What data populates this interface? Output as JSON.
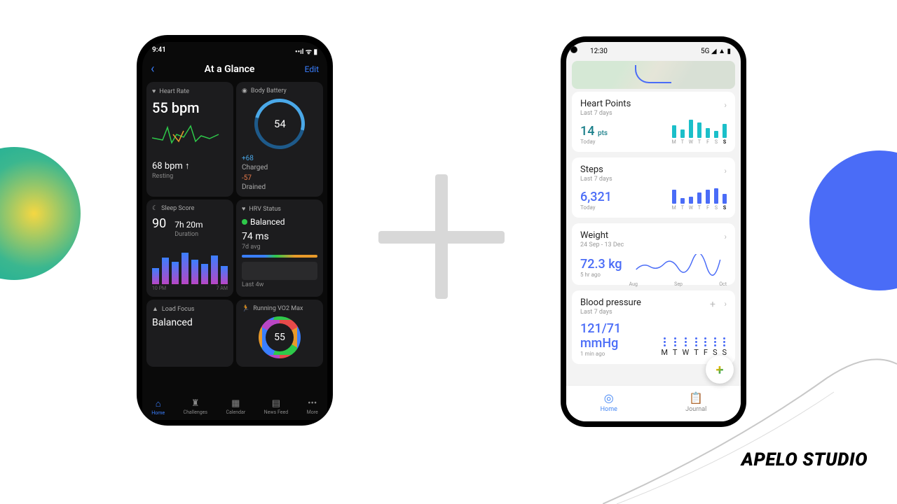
{
  "brand": "APELO STUDIO",
  "phone1": {
    "status_time": "9:41",
    "header": {
      "title": "At a Glance",
      "edit": "Edit"
    },
    "heart_rate": {
      "label": "Heart Rate",
      "value": "55 bpm",
      "resting_value": "68 bpm ↑",
      "resting_label": "Resting"
    },
    "body_battery": {
      "label": "Body Battery",
      "value": "54",
      "charged_value": "+68",
      "charged_label": "Charged",
      "drained_value": "-57",
      "drained_label": "Drained"
    },
    "sleep": {
      "label": "Sleep Score",
      "score": "90",
      "duration": "7h 20m",
      "duration_label": "Duration",
      "time_start": "10 PM",
      "time_end": "7 AM"
    },
    "hrv": {
      "label": "HRV Status",
      "status": "Balanced",
      "value": "74 ms",
      "sub": "7d avg",
      "period": "Last 4w"
    },
    "load_focus": {
      "label": "Load Focus",
      "value": "Balanced"
    },
    "vo2": {
      "label": "Running VO2 Max",
      "value": "55"
    },
    "tabs": {
      "home": "Home",
      "challenges": "Challenges",
      "calendar": "Calendar",
      "newsfeed": "News Feed",
      "more": "More"
    }
  },
  "phone2": {
    "status_time": "12:30",
    "status_net": "5G",
    "heart_points": {
      "title": "Heart Points",
      "sub": "Last 7 days",
      "value": "14",
      "unit": "pts",
      "when": "Today",
      "days": [
        "M",
        "T",
        "W",
        "T",
        "F",
        "S",
        "S"
      ],
      "bars": [
        18,
        12,
        26,
        22,
        14,
        10,
        20
      ]
    },
    "steps": {
      "title": "Steps",
      "sub": "Last 7 days",
      "value": "6,321",
      "when": "Today",
      "days": [
        "M",
        "T",
        "W",
        "T",
        "F",
        "S",
        "S"
      ],
      "bars": [
        20,
        8,
        10,
        16,
        20,
        22,
        14
      ]
    },
    "weight": {
      "title": "Weight",
      "sub": "24 Sep - 13 Dec",
      "value": "72.3",
      "unit": "kg",
      "when": "5 hr ago",
      "months": [
        "Aug",
        "Sep",
        "Oct"
      ]
    },
    "bp": {
      "title": "Blood pressure",
      "sub": "Last 7 days",
      "value": "121/71",
      "unit": "mmHg",
      "when": "1 min ago",
      "days": [
        "M",
        "T",
        "W",
        "T",
        "F",
        "S",
        "S"
      ]
    },
    "nav": {
      "home": "Home",
      "journal": "Journal"
    }
  },
  "chart_data": [
    {
      "type": "bar",
      "title": "Heart Points",
      "categories": [
        "M",
        "T",
        "W",
        "T",
        "F",
        "S",
        "S"
      ],
      "values": [
        18,
        12,
        26,
        22,
        14,
        10,
        20
      ],
      "ylabel": "pts"
    },
    {
      "type": "bar",
      "title": "Steps",
      "categories": [
        "M",
        "T",
        "W",
        "T",
        "F",
        "S",
        "S"
      ],
      "values": [
        20,
        8,
        10,
        16,
        20,
        22,
        14
      ]
    },
    {
      "type": "line",
      "title": "Weight",
      "x": [
        "Aug",
        "Sep",
        "Oct"
      ],
      "values": [
        72.0,
        72.5,
        72.1,
        72.8,
        72.3,
        72.6,
        72.2,
        72.9,
        72.3
      ],
      "unit": "kg"
    },
    {
      "type": "bar",
      "title": "Sleep Score stages",
      "categories": [
        "10 PM",
        "7 AM"
      ],
      "values": [
        40,
        65,
        55,
        78,
        60,
        50,
        70,
        45
      ]
    }
  ]
}
